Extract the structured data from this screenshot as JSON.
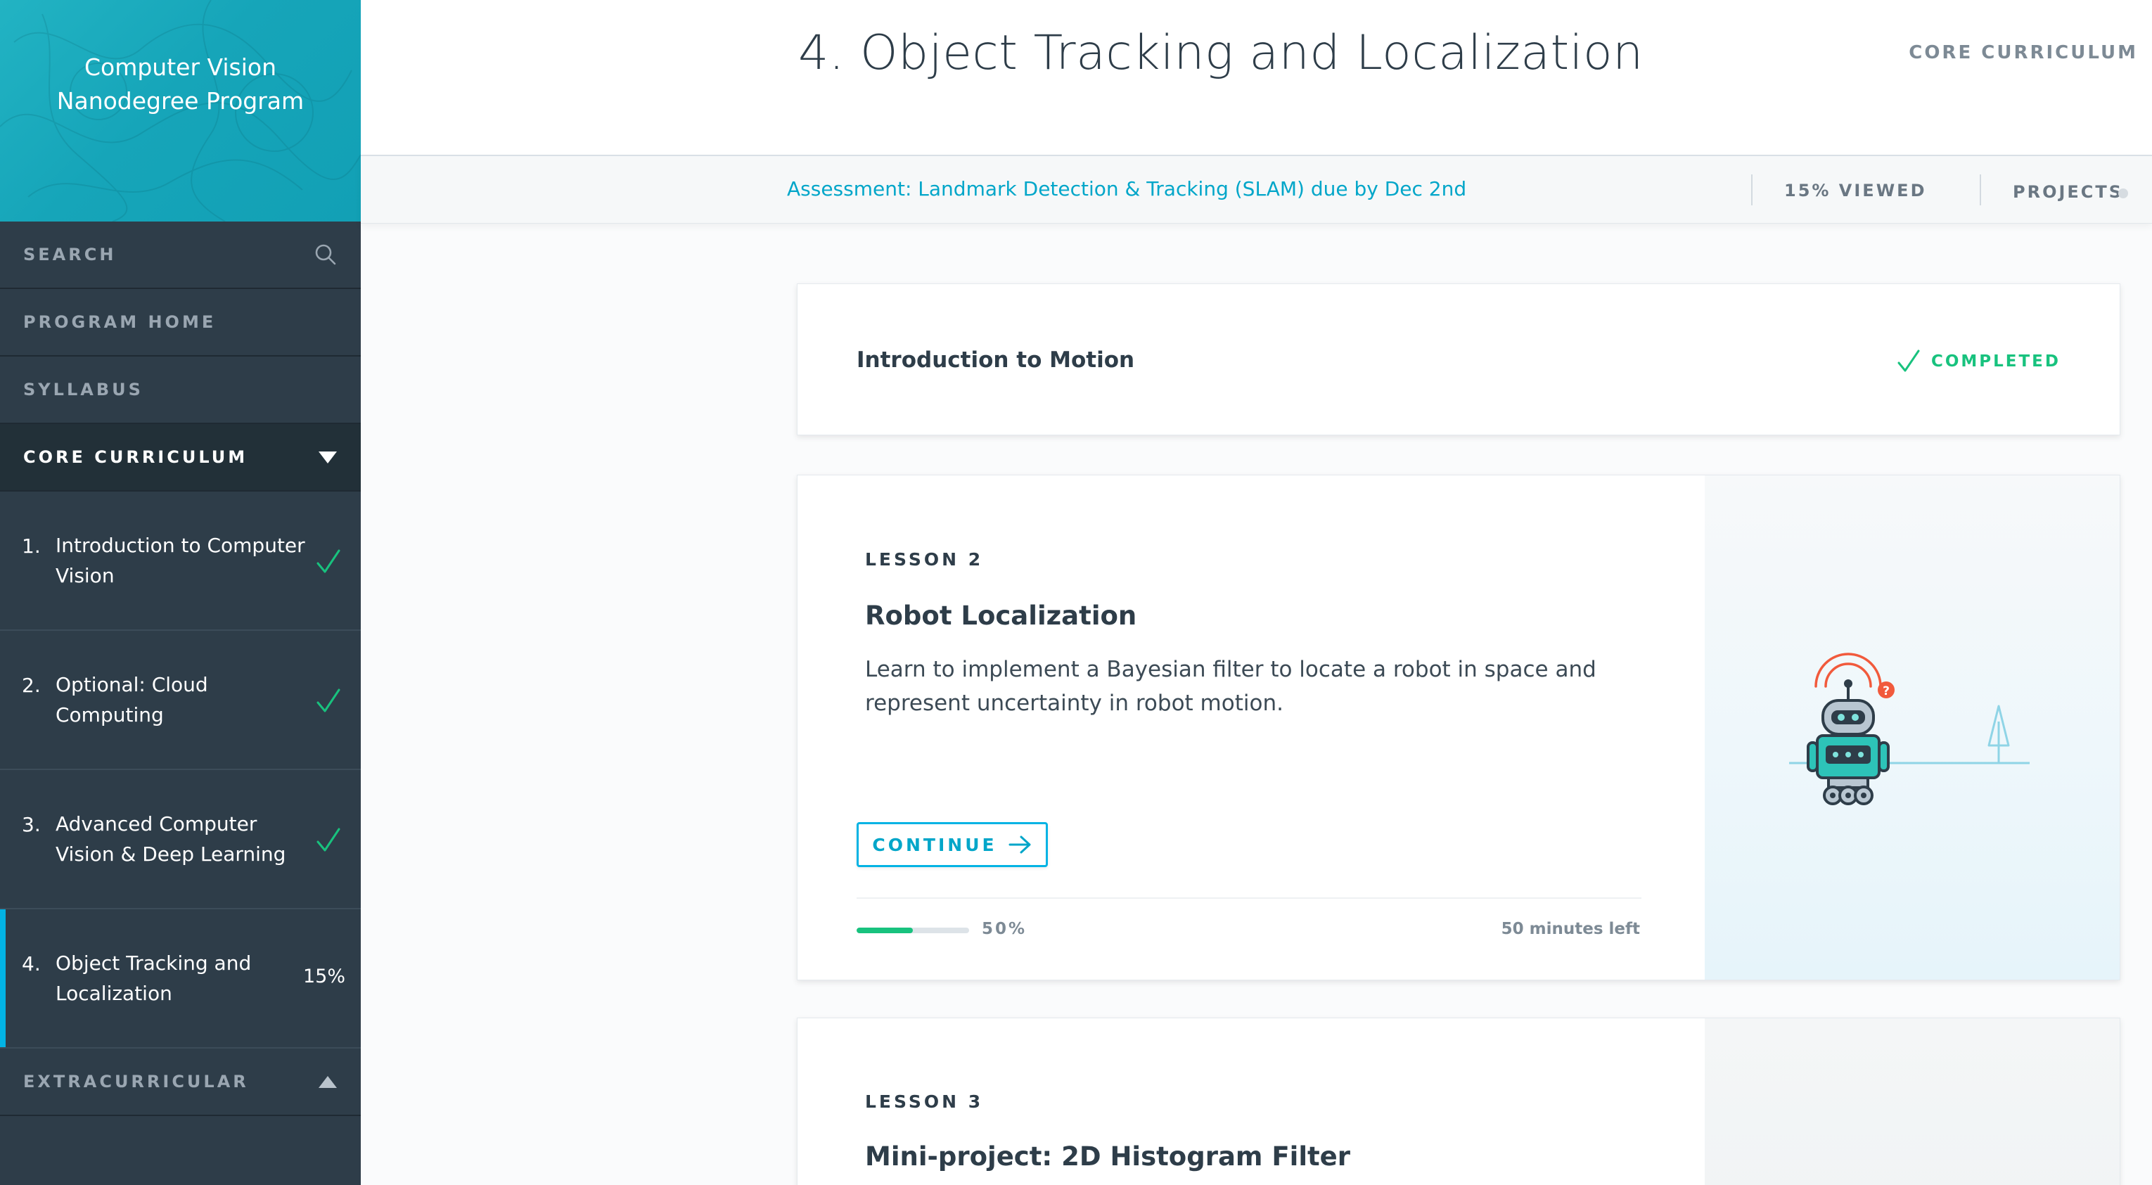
{
  "sidebar": {
    "brand_title": "Computer Vision Nanodegree Program",
    "search_label": "SEARCH",
    "program_home_label": "PROGRAM HOME",
    "syllabus_label": "SYLLABUS",
    "core_curriculum_label": "CORE CURRICULUM",
    "extracurricular_label": "EXTRACURRICULAR",
    "lessons": [
      {
        "num": "1.",
        "label": "Introduction to Computer Vision",
        "status": "completed"
      },
      {
        "num": "2.",
        "label": "Optional: Cloud Computing",
        "status": "completed"
      },
      {
        "num": "3.",
        "label": "Advanced Computer Vision & Deep Learning",
        "status": "completed"
      },
      {
        "num": "4.",
        "label": "Object Tracking and Localization",
        "status": "current",
        "progress": "15%"
      }
    ]
  },
  "header": {
    "title": "4. Object Tracking and Localization",
    "crumb": "CORE CURRICULUM"
  },
  "subbar": {
    "assessment": "Assessment: Landmark Detection & Tracking (SLAM) due by Dec 2nd",
    "viewed": "15% VIEWED",
    "projects": "PROJECTS"
  },
  "cards": {
    "intro": {
      "title": "Introduction to Motion",
      "status": "COMPLETED"
    },
    "lesson2": {
      "kicker": "LESSON 2",
      "title": "Robot Localization",
      "description": "Learn to implement a Bayesian filter to locate a robot in space and represent uncertainty in robot motion.",
      "button_label": "CONTINUE",
      "progress": 0.5,
      "progress_label": "50%",
      "time_left": "50 minutes left"
    },
    "lesson3": {
      "kicker": "LESSON 3",
      "title": "Mini-project: 2D Histogram Filter"
    }
  },
  "colors": {
    "accent": "#02b3e4",
    "success": "#18c27e",
    "sidebar_bg": "#2e3d49",
    "brand_teal": "#16a5b9",
    "robot_red": "#f15a3c",
    "robot_teal": "#2dc3b8"
  },
  "icons": {
    "search": "search-icon",
    "check": "check-icon",
    "caret_down": "caret-down-icon",
    "caret_up": "caret-up-icon",
    "arrow_right": "arrow-right-icon",
    "robot": "robot-illustration"
  }
}
